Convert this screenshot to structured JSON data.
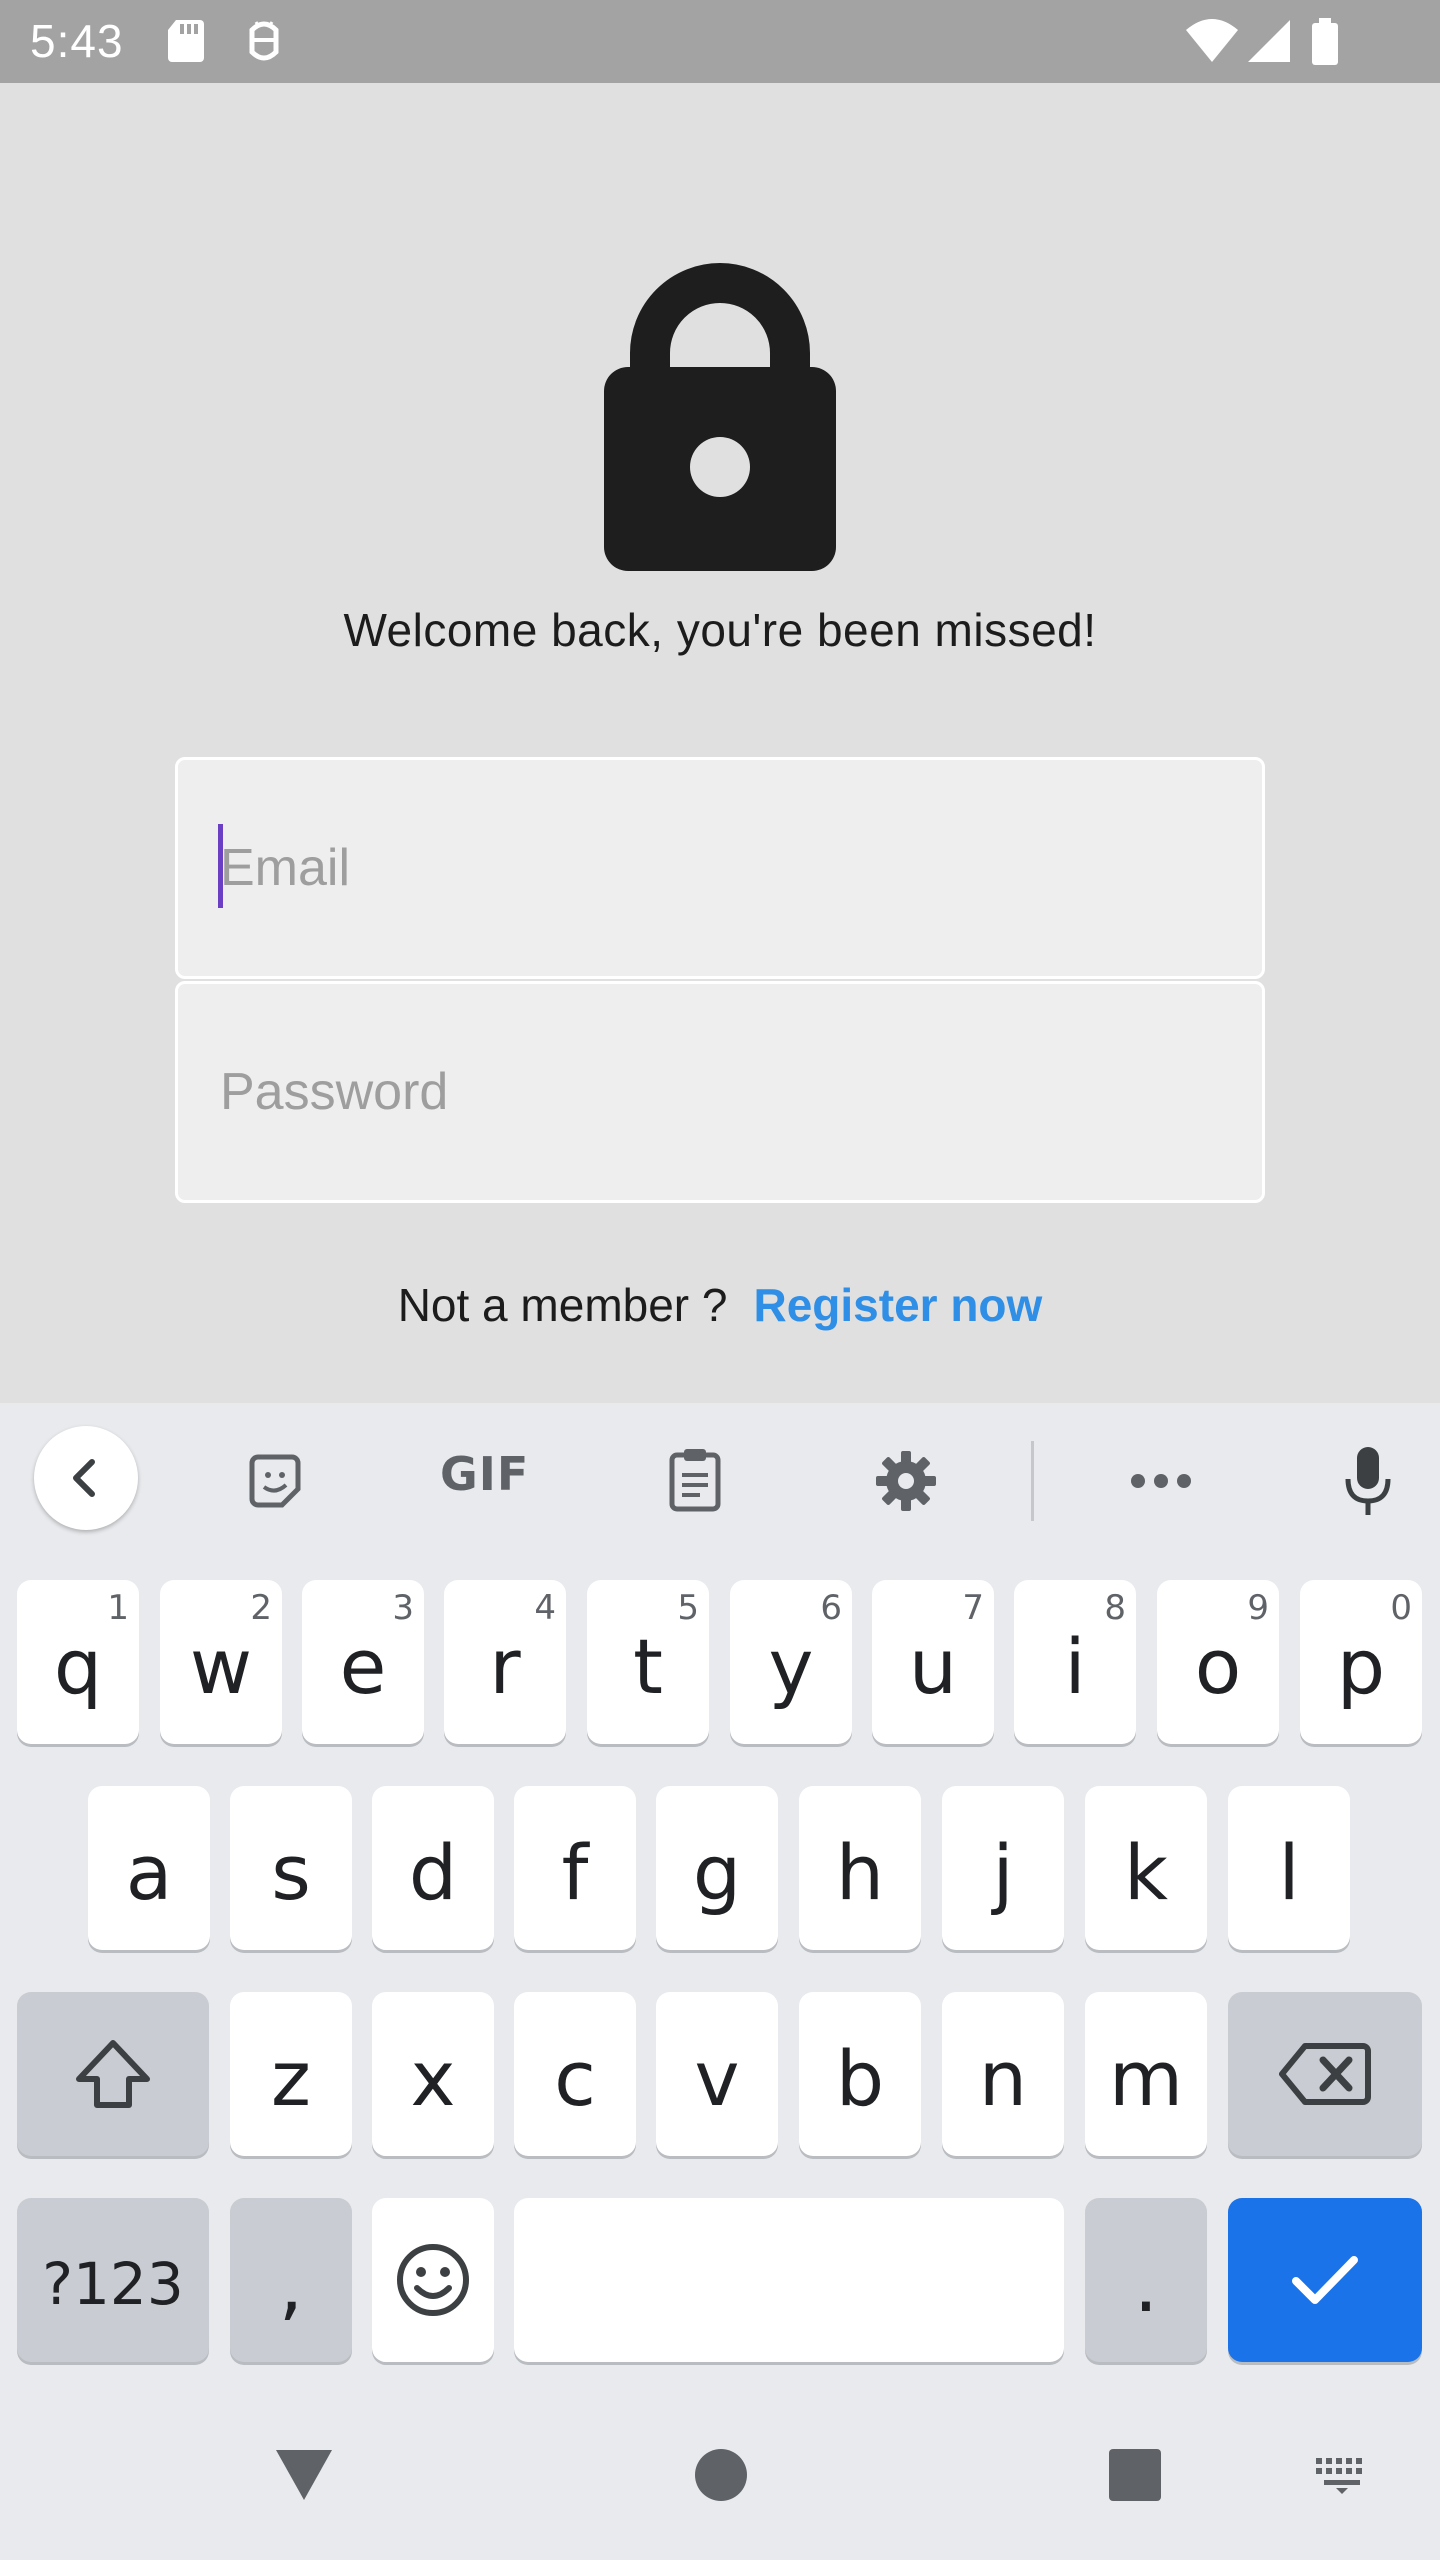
{
  "status_bar": {
    "time": "5:43"
  },
  "login": {
    "welcome_text": "Welcome back, you're been missed!",
    "email_placeholder": "Email",
    "password_placeholder": "Password",
    "not_member_text": "Not a member ?",
    "register_link": "Register now"
  },
  "keyboard": {
    "toolbar": {
      "gif_label": "GIF"
    },
    "row1": [
      {
        "key": "q",
        "hint": "1"
      },
      {
        "key": "w",
        "hint": "2"
      },
      {
        "key": "e",
        "hint": "3"
      },
      {
        "key": "r",
        "hint": "4"
      },
      {
        "key": "t",
        "hint": "5"
      },
      {
        "key": "y",
        "hint": "6"
      },
      {
        "key": "u",
        "hint": "7"
      },
      {
        "key": "i",
        "hint": "8"
      },
      {
        "key": "o",
        "hint": "9"
      },
      {
        "key": "p",
        "hint": "0"
      }
    ],
    "row2": [
      "a",
      "s",
      "d",
      "f",
      "g",
      "h",
      "j",
      "k",
      "l"
    ],
    "row3": [
      "z",
      "x",
      "c",
      "v",
      "b",
      "n",
      "m"
    ],
    "row4": {
      "symbols": "?123",
      "comma": ",",
      "period": "."
    }
  },
  "colors": {
    "accent": "#1a73e8",
    "link": "#2f8ee5",
    "caret": "#6a3fc4",
    "status_bar": "#a3a3a3"
  }
}
